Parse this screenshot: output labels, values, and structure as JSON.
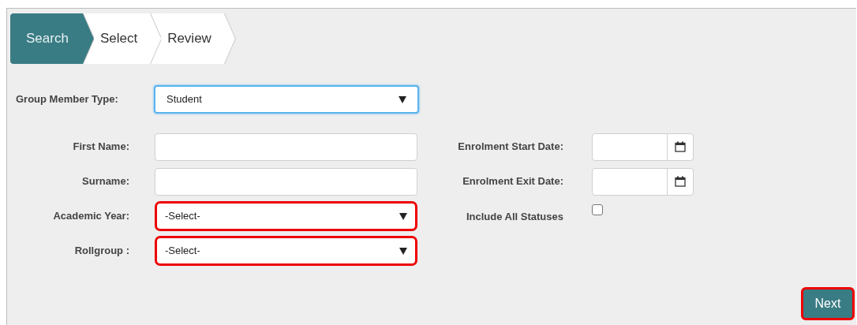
{
  "steps": [
    {
      "label": "Search",
      "selected": true
    },
    {
      "label": "Select",
      "selected": false
    },
    {
      "label": "Review",
      "selected": false
    }
  ],
  "member_type": {
    "label": "Group Member Type:",
    "value": "Student",
    "focused": true
  },
  "left_fields": [
    {
      "kind": "text",
      "label": "First Name:",
      "highlighted": false
    },
    {
      "kind": "text",
      "label": "Surname:",
      "highlighted": false
    },
    {
      "kind": "select",
      "label": "Academic Year:",
      "value": "-Select-",
      "highlighted": true
    },
    {
      "kind": "select",
      "label": "Rollgroup :",
      "value": "-Select-",
      "highlighted": true
    }
  ],
  "right_fields": [
    {
      "kind": "date",
      "label": "Enrolment Start Date:"
    },
    {
      "kind": "date",
      "label": "Enrolment Exit Date:"
    },
    {
      "kind": "checkbox",
      "label": "Include All Statuses",
      "checked": false
    }
  ],
  "next_button": {
    "label": "Next",
    "highlighted": true
  }
}
